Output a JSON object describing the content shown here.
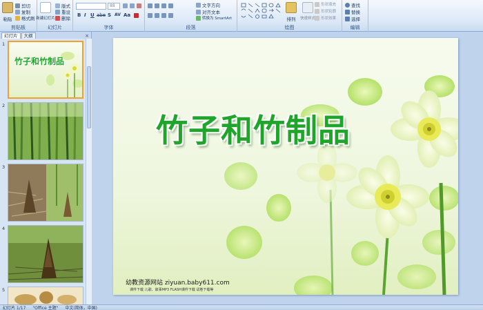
{
  "ribbon": {
    "groups": {
      "clipboard": "剪贴板",
      "slides": "幻灯片",
      "font": "字体",
      "paragraph": "段落",
      "drawing": "绘图",
      "editing": "编辑"
    },
    "clipboard": {
      "paste": "粘贴",
      "cut": "剪切",
      "copy": "复制",
      "format_painter": "格式刷"
    },
    "slides": {
      "new_slide": "新建幻灯片",
      "layout": "版式",
      "reset": "重设",
      "delete": "删除"
    },
    "font": {
      "font_name": "",
      "font_size": "88",
      "bold": "B",
      "italic": "I",
      "underline": "U",
      "strike": "abe",
      "shadow": "S",
      "spacing": "AV",
      "case": "Aa"
    },
    "paragraph": {
      "text_direction": "文字方向",
      "align_text": "对齐文本",
      "convert_smartart": "转换为 SmartArt"
    },
    "drawing": {
      "arrange": "排列",
      "quick_styles": "快速样式",
      "shape_fill": "形状填充",
      "shape_outline": "形状轮廓",
      "shape_effects": "形状效果"
    },
    "editing": {
      "find": "查找",
      "replace": "替换",
      "select": "选择"
    }
  },
  "leftpane": {
    "tab_slides": "幻灯片",
    "tab_outline": "大纲",
    "close": "×",
    "slides": [
      {
        "num": "1",
        "title": "竹子和竹制品"
      },
      {
        "num": "2"
      },
      {
        "num": "3"
      },
      {
        "num": "4"
      },
      {
        "num": "5"
      }
    ]
  },
  "slide": {
    "title": "竹子和竹制品",
    "site": "幼教资源网站   ziyuan.baby611.com",
    "site_sub": "课件下载  儿歌、故事MP3  FLASH课件下载  试卷下载等"
  },
  "status": {
    "slide_count": "幻灯片 1/17",
    "theme": "\"Office 主题\"",
    "language": "中文(简体，中国)"
  },
  "colors": {
    "title_green": "#1fa52a",
    "selected_thumb": "#f0a030"
  }
}
